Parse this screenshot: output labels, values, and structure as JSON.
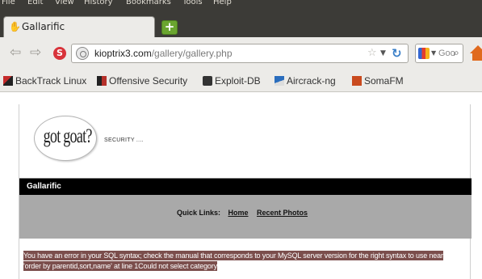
{
  "browser": {
    "menu": [
      "File",
      "Edit",
      "View",
      "History",
      "Bookmarks",
      "Tools",
      "Help"
    ],
    "tab": {
      "title": "Gallarific"
    },
    "url": {
      "domain": "kioptrix3.com",
      "path": "/gallery/gallery.php"
    },
    "search_placeholder": "Goo",
    "bookmarks": [
      "BackTrack Linux",
      "Offensive Security",
      "Exploit-DB",
      "Aircrack-ng",
      "SomaFM"
    ],
    "colors": {
      "chrome_dark": "#3c3b37",
      "chrome_light": "#ecebe8"
    }
  },
  "page": {
    "logo_text": "got goat?",
    "tagline": "SECURITY ....",
    "site_title": "Gallarific",
    "quick_links": {
      "label": "Quick Links:",
      "links": [
        "Home",
        "Recent Photos"
      ]
    },
    "error_message": "You have an error in your SQL syntax; check the manual that corresponds to your MySQL server version for the right syntax to use near 'order by parentid,sort,name' at line 1Could not select category",
    "colors": {
      "title_bar": "#000000",
      "quick_links_bg": "#a9a9a9",
      "error_highlight": "#7b4e4c"
    }
  }
}
